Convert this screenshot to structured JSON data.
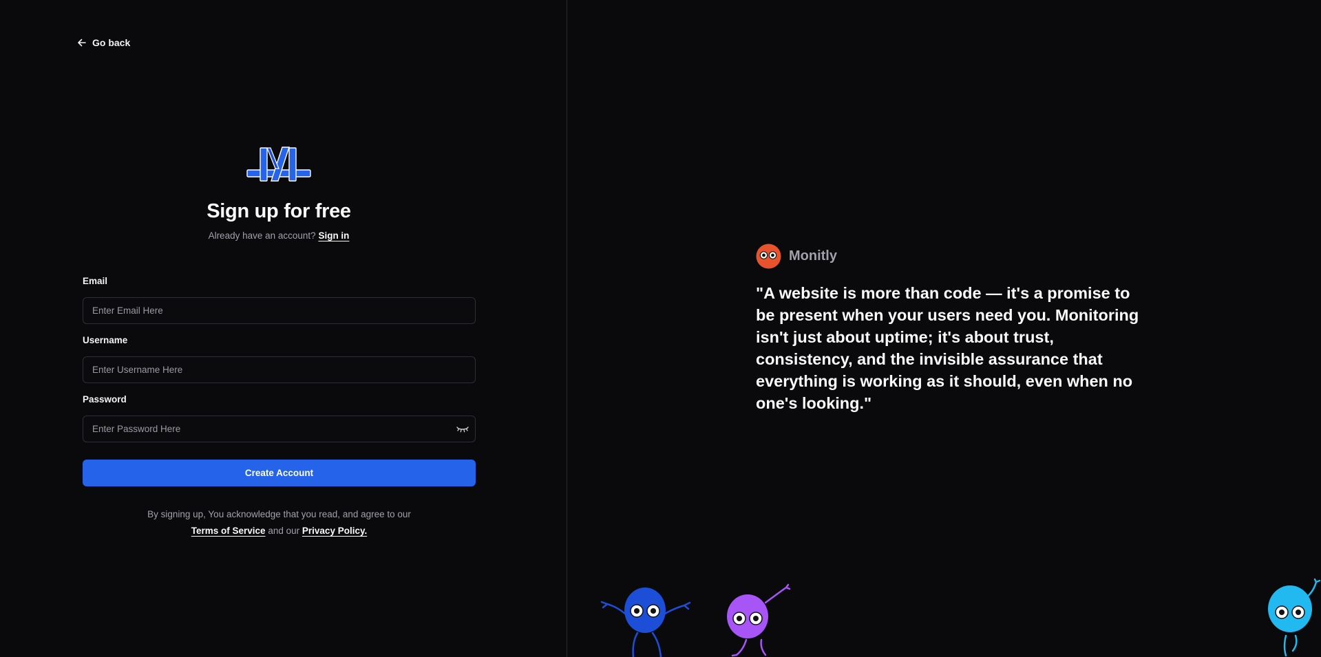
{
  "nav": {
    "back_label": "Go back"
  },
  "header": {
    "title": "Sign up for free",
    "have_account_text": "Already have an account?",
    "sign_in_link": "Sign in"
  },
  "form": {
    "email": {
      "label": "Email",
      "placeholder": "Enter Email Here",
      "value": ""
    },
    "username": {
      "label": "Username",
      "placeholder": "Enter Username Here",
      "value": ""
    },
    "password": {
      "label": "Password",
      "placeholder": "Enter Password Here",
      "value": ""
    },
    "submit_label": "Create Account"
  },
  "terms": {
    "prefix": "By signing up, You acknowledge that you read, and agree to our",
    "tos_link": "Terms of Service",
    "connector": "and our",
    "privacy_link": "Privacy Policy."
  },
  "testimonial": {
    "brand_name": "Monitly",
    "quote": "\"A website is more than code — it's a promise to be present when your users need you. Monitoring isn't just about uptime; it's about trust, consistency, and the invisible assurance that everything is working as it should, even when no one's looking.\""
  },
  "icons": {
    "back": "arrow-left-icon",
    "logo": "monitly-logo",
    "password_toggle": "eye-closed-icon",
    "brand_avatar": "mascot-avatar",
    "mascots": [
      "blue-mascot",
      "purple-mascot",
      "cyan-mascot"
    ]
  },
  "colors": {
    "background": "#0a0a0d",
    "accent": "#2563eb",
    "brand_avatar": "#e8532e",
    "mascot_blue": "#1d4ed8",
    "mascot_purple": "#a855f7",
    "mascot_cyan": "#22b8f0"
  }
}
